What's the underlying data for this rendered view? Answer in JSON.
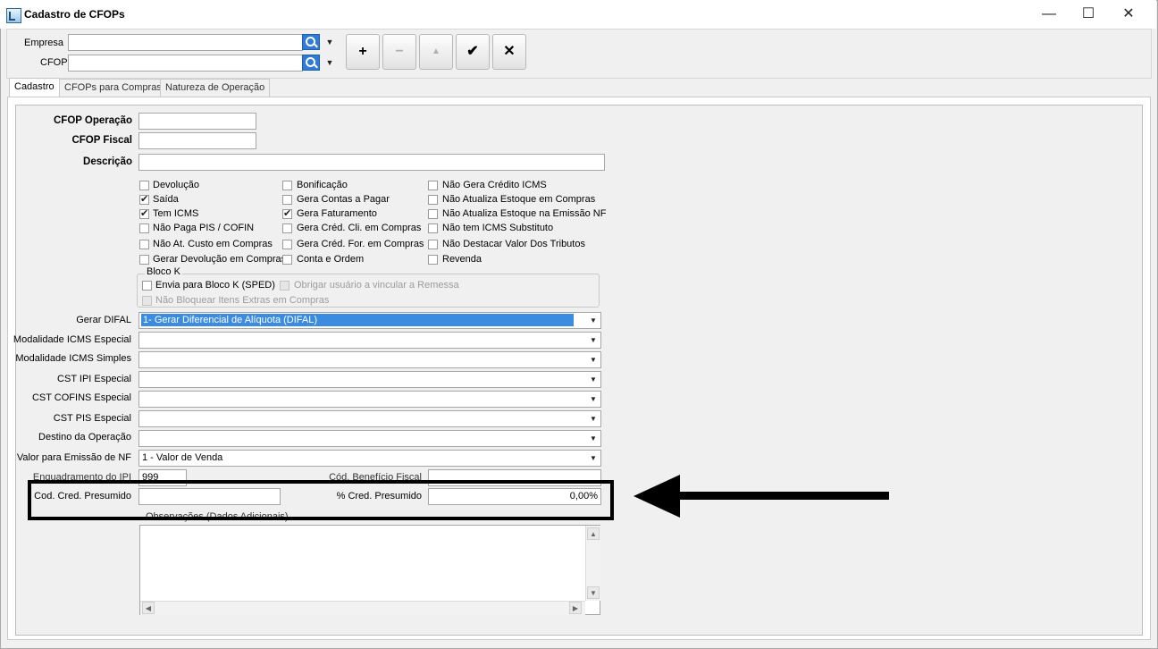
{
  "window": {
    "title": "Cadastro de CFOPs",
    "minimize_symbol": "—",
    "maximize_symbol": "☐",
    "close_symbol": "✕"
  },
  "header": {
    "empresa_label": "Empresa",
    "empresa_value": "",
    "cfop_label": "CFOP",
    "cfop_value": ""
  },
  "toolbar": {
    "add": "+",
    "remove": "−",
    "up": "▲",
    "confirm": "✔",
    "cancel": "✕"
  },
  "tabs": [
    "Cadastro",
    "CFOPs para Compras",
    "Natureza de Operação"
  ],
  "form": {
    "cfop_operacao_label": "CFOP Operação",
    "cfop_operacao_value": "",
    "cfop_fiscal_label": "CFOP Fiscal",
    "cfop_fiscal_value": "",
    "descricao_label": "Descrição",
    "descricao_value": ""
  },
  "checkboxes": {
    "col1": [
      {
        "label": "Devolução",
        "checked": false
      },
      {
        "label": "Saída",
        "checked": true
      },
      {
        "label": "Tem ICMS",
        "checked": true
      },
      {
        "label": "Não Paga PIS / COFINS",
        "checked": false
      },
      {
        "label": "Não At. Custo em Compras",
        "checked": false
      },
      {
        "label": "Gerar Devolução em Compras",
        "checked": false
      }
    ],
    "col2": [
      {
        "label": "Bonificação",
        "checked": false
      },
      {
        "label": "Gera Contas a Pagar",
        "checked": false
      },
      {
        "label": "Gera Faturamento",
        "checked": true
      },
      {
        "label": "Gera Créd. Cli. em Compras",
        "checked": false
      },
      {
        "label": "Gera Créd. For. em Compras",
        "checked": false
      },
      {
        "label": "Conta e Ordem",
        "checked": false
      }
    ],
    "col3": [
      {
        "label": "Não Gera Crédito ICMS",
        "checked": false
      },
      {
        "label": "Não Atualiza Estoque em Compras",
        "checked": false
      },
      {
        "label": "Não Atualiza Estoque na Emissão NF",
        "checked": false
      },
      {
        "label": "Não tem ICMS Substituto",
        "checked": false
      },
      {
        "label": "Não Destacar Valor Dos Tributos",
        "checked": false
      },
      {
        "label": "Revenda",
        "checked": false
      }
    ]
  },
  "bloco_k": {
    "title": "Bloco K",
    "envia": "Envia para Bloco K (SPED)",
    "obrigar": "Obrigar usuário a vincular a Remessa",
    "nao_bloquear": "Não Bloquear Itens Extras em Compras"
  },
  "combos": [
    {
      "label": "Gerar DIFAL",
      "value": "1- Gerar Diferencial de Alíquota (DIFAL)"
    },
    {
      "label": "Modalidade ICMS Especial",
      "value": ""
    },
    {
      "label": "Modalidade ICMS Simples",
      "value": ""
    },
    {
      "label": "CST IPI Especial",
      "value": ""
    },
    {
      "label": "CST COFINS Especial",
      "value": ""
    },
    {
      "label": "CST PIS Especial",
      "value": ""
    },
    {
      "label": "Destino da Operação",
      "value": ""
    },
    {
      "label": "Valor para Emissão de NF",
      "value": "1 - Valor de Venda"
    }
  ],
  "enquadramento": {
    "label": "Enquadramento do IPI",
    "value": "999",
    "cod_beneficio_label": "Cód. Benefício Fiscal",
    "cod_beneficio_value": ""
  },
  "cred_presumido": {
    "cod_label": "Cod. Cred. Presumido",
    "cod_value": "",
    "pct_label": "% Cred. Presumido",
    "pct_value": "0,00%"
  },
  "observacoes": {
    "label": "Observações (Dados Adicionais)",
    "value": ""
  },
  "dropdown_arrow": "▼",
  "scroll": {
    "up": "▲",
    "down": "▼",
    "left": "◀",
    "right": "▶"
  }
}
